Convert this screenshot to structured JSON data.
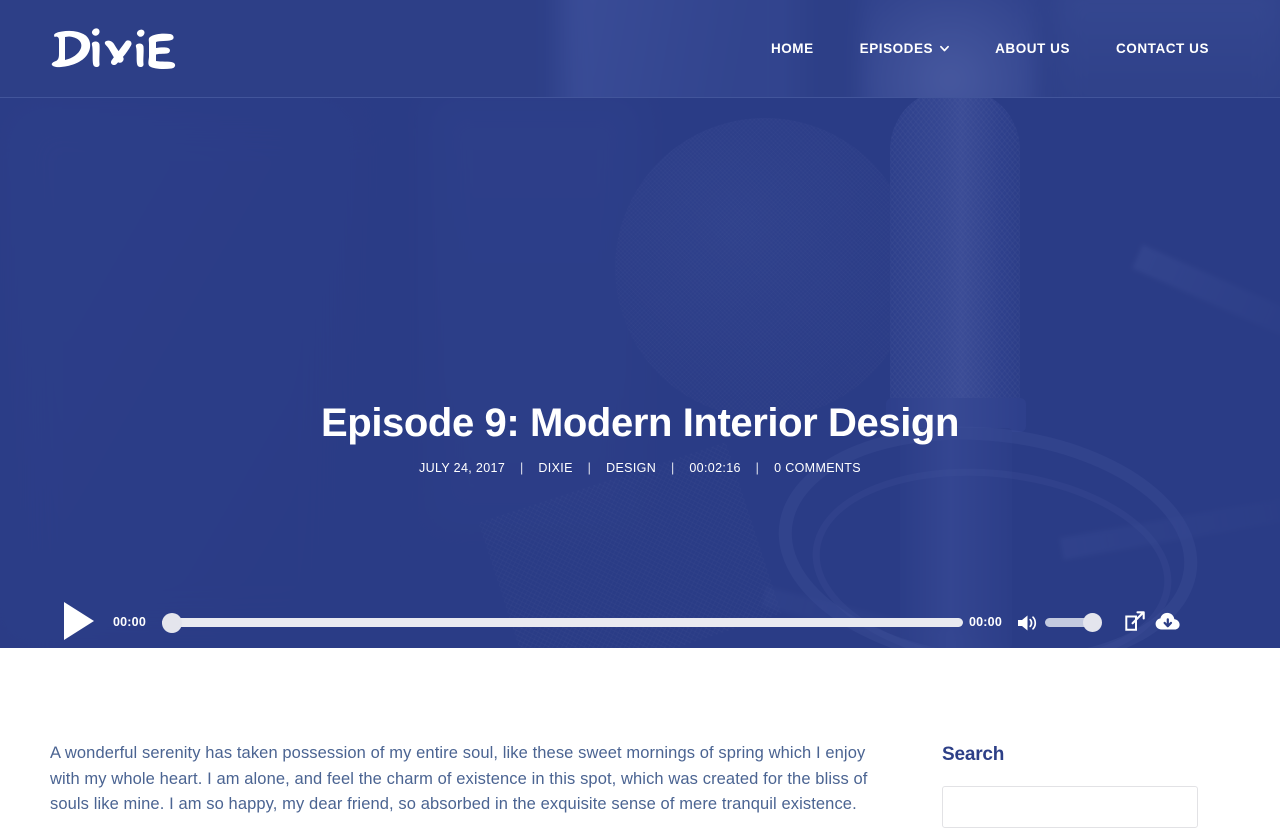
{
  "site": {
    "logo_text": "Dixie",
    "brand_color": "#2d3f87"
  },
  "nav": {
    "items": [
      {
        "label": "HOME",
        "has_dropdown": false
      },
      {
        "label": "EPISODES",
        "has_dropdown": true
      },
      {
        "label": "ABOUT US",
        "has_dropdown": false
      },
      {
        "label": "CONTACT US",
        "has_dropdown": false
      }
    ]
  },
  "hero": {
    "title": "Episode 9: Modern Interior Design",
    "meta": {
      "date": "JULY 24, 2017",
      "author": "DIXIE",
      "category": "DESIGN",
      "duration": "00:02:16",
      "comments": "0 COMMENTS",
      "separator": "|"
    }
  },
  "player": {
    "play_label": "play-button",
    "current_time": "00:00",
    "total_time": "00:00",
    "progress_percent": 0,
    "volume_percent": 100,
    "icons": {
      "play": "play-icon",
      "volume": "volume-icon",
      "share": "share-external-icon",
      "download": "cloud-download-icon"
    }
  },
  "article": {
    "paragraph": "A wonderful serenity has taken possession of my entire soul, like these sweet mornings of spring which I enjoy with my whole heart. I am alone, and feel the charm of existence in this spot, which was created for the bliss of souls like mine. I am so happy, my dear friend, so absorbed in the exquisite sense of mere tranquil existence."
  },
  "sidebar": {
    "search_widget": {
      "title": "Search",
      "input_value": "",
      "placeholder": ""
    }
  }
}
